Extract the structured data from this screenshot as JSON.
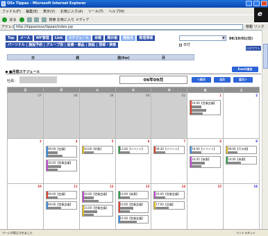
{
  "window": {
    "title": "OSx Tippas - Microsoft Internet Explorer"
  },
  "menu": [
    "ファイル(F)",
    "編集(E)",
    "表示(V)",
    "お気に入り(A)",
    "ツール(T)",
    "ヘルプ(H)"
  ],
  "toolbar": {
    "back": "戻る",
    "items": "検索 お気に入り メディア"
  },
  "address": {
    "label": "アドレス(D)",
    "url": "http://tippas/osx/tippas/index.jsp",
    "go": "移動 リンク"
  },
  "nav": {
    "row1": [
      "Top",
      "メール",
      "WF管理",
      "Link",
      "スケジュール",
      "目報",
      "掲示板",
      "施設名",
      "管理情報"
    ],
    "row2": "パーソナル | 施設予約 | グループ別 | 設備・備品 | 施設 | 登録・検索",
    "date": "06/10/01(日)",
    "checkbox_label": "日付",
    "logout": "ログアウト"
  },
  "view_tabs": [
    "日",
    "週",
    "週(6w)",
    "月"
  ],
  "section": {
    "title": "■月間スケジュール",
    "register": "Event追加"
  },
  "owner_label": "社員：",
  "month": "06年09月",
  "nav_buttons": {
    "prev": "＜前月",
    "today": "当月",
    "next": "翌月＞"
  },
  "calendar": {
    "headers": [
      "日",
      "月",
      "火",
      "水",
      "木",
      "金",
      "土"
    ],
    "weeks": [
      [
        {
          "day": "27",
          "out": true,
          "events": []
        },
        {
          "day": "28",
          "out": true,
          "events": []
        },
        {
          "day": "29",
          "out": true,
          "events": []
        },
        {
          "day": "30",
          "out": true,
          "events": []
        },
        {
          "day": "31",
          "out": true,
          "events": []
        },
        {
          "day": "1",
          "out": false,
          "events": [
            {
              "time": "10:00",
              "label": "【営業会議】",
              "lines": 3
            }
          ]
        },
        {
          "day": "2",
          "out": false,
          "events": []
        }
      ],
      [
        {
          "day": "3",
          "out": false,
          "events": []
        },
        {
          "day": "4",
          "out": false,
          "events": [
            {
              "time": "09:00",
              "label": "【会議】",
              "lines": 2
            },
            {
              "time": "10:00",
              "label": "【営業会議】",
              "lines": 2
            }
          ]
        },
        {
          "day": "5",
          "out": false,
          "events": [
            {
              "time": "10:00",
              "label": "【外勤】",
              "lines": 1
            }
          ]
        },
        {
          "day": "6",
          "out": false,
          "events": [
            {
              "time": "13:00",
              "label": "【イベント】",
              "lines": 1
            }
          ]
        },
        {
          "day": "7",
          "out": false,
          "events": [
            {
              "time": "09:30",
              "label": "【イベント】",
              "lines": 1
            }
          ]
        },
        {
          "day": "8",
          "out": false,
          "events": [
            {
              "time": "10:00",
              "label": "【イベント】",
              "lines": 1
            },
            {
              "time": "14:45",
              "label": "【来客】",
              "lines": 2
            }
          ]
        },
        {
          "day": "9",
          "out": false,
          "events": [
            {
              "time": "09:00",
              "label": "【その他】",
              "lines": 1
            },
            {
              "time": "14:00",
              "label": "【来客】",
              "lines": 1
            }
          ]
        }
      ],
      [
        {
          "day": "10",
          "out": false,
          "events": []
        },
        {
          "day": "11",
          "out": false,
          "events": [
            {
              "time": "09:00",
              "label": "【会議】",
              "lines": 1
            },
            {
              "time": "09:00",
              "label": "【営業会議】",
              "lines": 1
            }
          ]
        },
        {
          "day": "12",
          "out": false,
          "events": [
            {
              "time": "10:00",
              "label": "【営業会議】",
              "lines": 2
            },
            {
              "time": "15:00",
              "label": "【営業会議】",
              "lines": 2
            }
          ]
        },
        {
          "day": "13",
          "out": false,
          "events": [
            {
              "time": "10:00",
              "label": "【来客】",
              "lines": 1
            },
            {
              "time": "10:00",
              "label": "【営業会議】",
              "lines": 2
            },
            {
              "time": "15:00",
              "label": "【営業会議】",
              "lines": 1
            }
          ]
        },
        {
          "day": "14",
          "out": false,
          "events": [
            {
              "time": "10:00",
              "label": "【営業会議】",
              "lines": 1
            },
            {
              "time": "17:00",
              "label": "【会議】",
              "lines": 1
            }
          ]
        },
        {
          "day": "15",
          "out": false,
          "events": []
        },
        {
          "day": "16",
          "out": false,
          "events": []
        }
      ]
    ]
  },
  "status": {
    "left": "ページが表示されました",
    "zone": "イントラネット"
  },
  "colors": {
    "nav": "#2c4fa8",
    "accent": "#2c64d8",
    "event_bars": [
      "#e0432e",
      "#3a8de0",
      "#c04ad0",
      "#e0c020",
      "#30a050"
    ]
  }
}
